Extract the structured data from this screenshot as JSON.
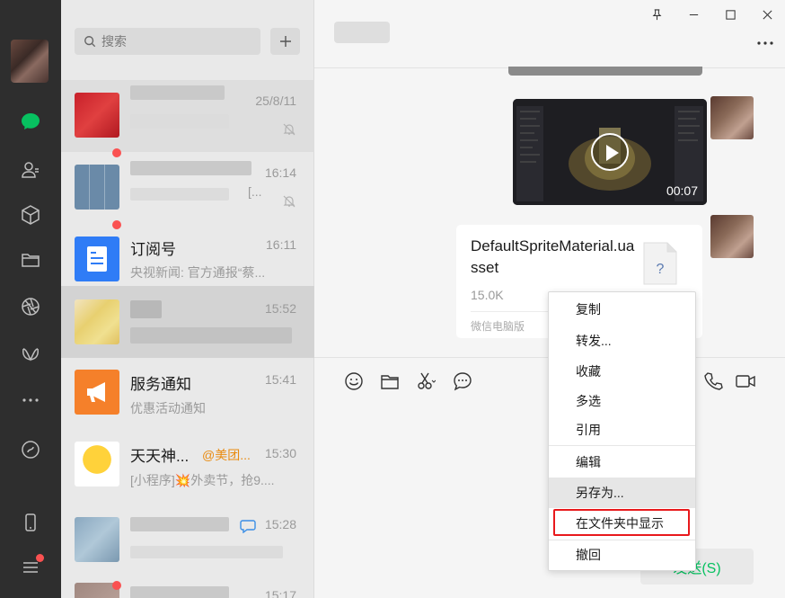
{
  "search": {
    "placeholder": "搜索"
  },
  "chats": [
    {
      "title": "",
      "time": "25/8/11",
      "preview": "",
      "muted": true
    },
    {
      "title": "",
      "time": "16:14",
      "preview": "[...",
      "muted": true,
      "unread": true
    },
    {
      "title": "订阅号",
      "time": "16:11",
      "preview": "央视新闻: 官方通报“蔡...",
      "unread": true
    },
    {
      "title": "",
      "time": "15:52",
      "preview": ""
    },
    {
      "title": "服务通知",
      "time": "15:41",
      "preview": "优惠活动通知"
    },
    {
      "title": "天天神...",
      "mention": "@美团...",
      "time": "15:30",
      "preview": "[小程序]💥外卖节，抢9...."
    },
    {
      "title": "",
      "time": "15:28",
      "preview": ""
    },
    {
      "title": "",
      "time": "15:17",
      "preview": ""
    }
  ],
  "video": {
    "duration": "00:07"
  },
  "file": {
    "name": "DefaultSpriteMaterial.uasset",
    "size": "15.0K",
    "source": "微信电脑版",
    "icon": "?"
  },
  "context_menu": {
    "items": [
      "复制",
      "转发...",
      "收藏",
      "多选",
      "引用",
      "编辑",
      "另存为...",
      "在文件夹中显示",
      "撤回"
    ],
    "hovered_item": "另存为...",
    "highlighted_item": "在文件夹中显示"
  },
  "send": {
    "label": "发送(S)"
  },
  "colors": {
    "accent": "#07c160",
    "unread": "#fa5151",
    "highlight": "#e8191c",
    "sidebar": "#2e2e2e"
  }
}
